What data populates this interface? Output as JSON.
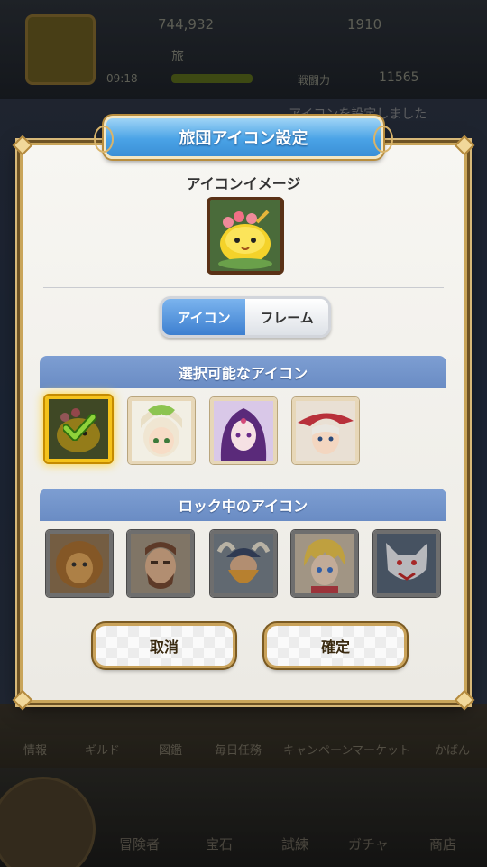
{
  "background": {
    "gold": "744,932",
    "gems": "1910",
    "player_name": "旅",
    "level_time": "09:18",
    "power_label": "戦闘力",
    "power_value": "11565",
    "notice": "アイコンを設定しました",
    "menu": [
      "情報",
      "ギルド",
      "図鑑",
      "毎日任務",
      "キャンペーン",
      "マーケット",
      "かばん"
    ],
    "bottom_nav": [
      "冒険者",
      "宝石",
      "試練",
      "ガチャ",
      "商店"
    ]
  },
  "dialog": {
    "title": "旅団アイコン設定",
    "image_label": "アイコンイメージ",
    "tabs": [
      "アイコン",
      "フレーム"
    ],
    "active_tab": "アイコン",
    "available_section": "選択可能なアイコン",
    "locked_section": "ロック中のアイコン",
    "available_icons": [
      "yellow-blob-icon",
      "leaf-hair-girl-icon",
      "purple-hair-woman-icon",
      "red-hat-swordsman-icon"
    ],
    "selected_index": 0,
    "locked_icons": [
      "lion-warrior-icon",
      "bearded-man-icon",
      "horned-dwarf-icon",
      "blonde-boy-icon",
      "wolf-beast-icon"
    ],
    "cancel_label": "取消",
    "confirm_label": "確定"
  },
  "colors": {
    "title_blue": "#4aa3e6",
    "section_blue": "#7d9ed2",
    "gold_border": "#c9a55a",
    "selected_glow": "#f4c21a"
  }
}
